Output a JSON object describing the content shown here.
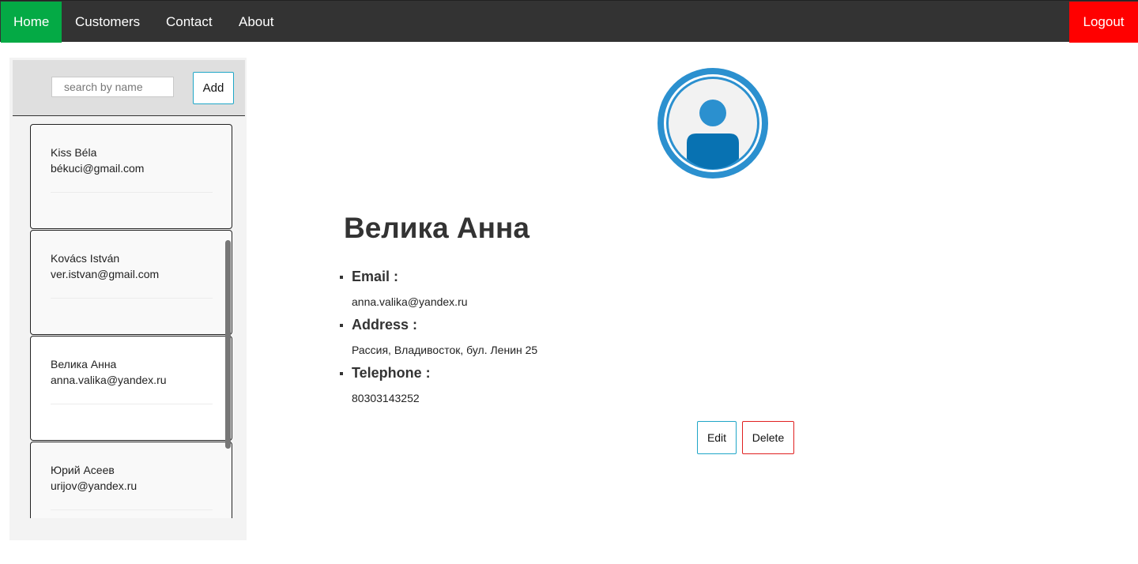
{
  "nav": {
    "home": "Home",
    "customers": "Customers",
    "contact": "Contact",
    "about": "About",
    "logout": "Logout"
  },
  "colors": {
    "nav_bg": "#333333",
    "home_active": "#04aa45",
    "logout": "#ff0000",
    "add_border": "#1fa6c7",
    "delete_border": "#e02020",
    "avatar_blue": "#2b90cf"
  },
  "sidebar": {
    "search_placeholder": "search by name",
    "add_label": "Add",
    "customers": [
      {
        "name": "Kiss Béla",
        "email": "békuci@gmail.com"
      },
      {
        "name": "Kovács István",
        "email": "ver.istvan@gmail.com"
      },
      {
        "name": "Велика Анна",
        "email": "anna.valika@yandex.ru"
      },
      {
        "name": "Юрий Асеев",
        "email": "urijov@yandex.ru"
      }
    ]
  },
  "detail": {
    "avatar_icon": "user-avatar-icon",
    "name": "Велика Анна",
    "email_label": "Email :",
    "email": "anna.valika@yandex.ru",
    "address_label": "Address :",
    "address": "Рассия, Владивосток, бул. Ленин 25",
    "telephone_label": "Telephone :",
    "telephone": "80303143252",
    "edit_label": "Edit",
    "delete_label": "Delete"
  }
}
